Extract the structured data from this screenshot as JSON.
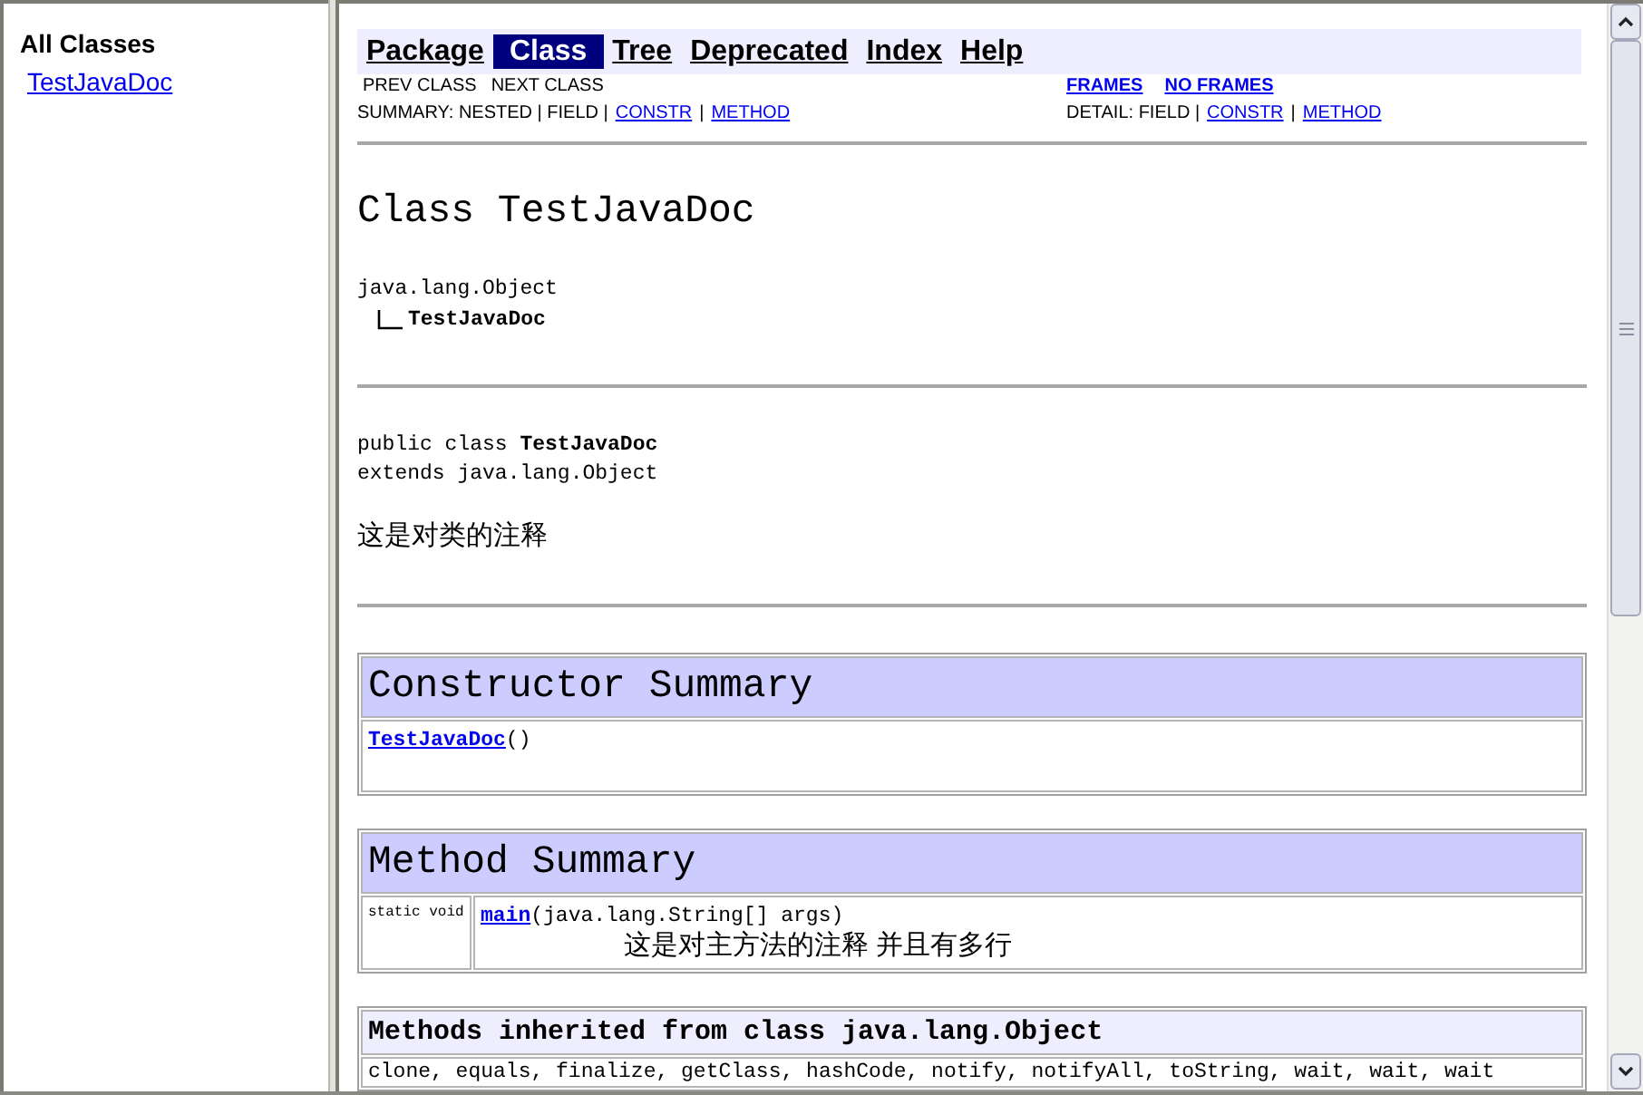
{
  "left_frame": {
    "heading": "All Classes",
    "classes": [
      "TestJavaDoc"
    ]
  },
  "navbar": {
    "items": [
      {
        "label": "Package",
        "selected": false
      },
      {
        "label": "Class",
        "selected": true
      },
      {
        "label": "Tree",
        "selected": false
      },
      {
        "label": "Deprecated",
        "selected": false
      },
      {
        "label": "Index",
        "selected": false
      },
      {
        "label": "Help",
        "selected": false
      }
    ]
  },
  "subnav": {
    "prev_next": [
      "PREV CLASS",
      "NEXT CLASS"
    ],
    "frames": [
      "FRAMES",
      "NO FRAMES"
    ],
    "summary": [
      {
        "kind": "text",
        "text": "SUMMARY: NESTED | FIELD |"
      },
      {
        "kind": "link",
        "text": "CONSTR"
      },
      {
        "kind": "text",
        "text": "|"
      },
      {
        "kind": "link",
        "text": "METHOD"
      }
    ],
    "detail": [
      {
        "kind": "text",
        "text": "DETAIL: FIELD |"
      },
      {
        "kind": "link",
        "text": "CONSTR"
      },
      {
        "kind": "text",
        "text": "|"
      },
      {
        "kind": "link",
        "text": "METHOD"
      }
    ]
  },
  "class_title": "Class TestJavaDoc",
  "hierarchy": {
    "name": "java.lang.Object",
    "children": [
      {
        "name": "TestJavaDoc"
      }
    ]
  },
  "declaration": [
    "public class **TestJavaDoc**",
    "extends java.lang.Object"
  ],
  "description": "这是对类的注释",
  "constructor_summary": {
    "title": "Constructor Summary",
    "rows": [
      {
        "name": "TestJavaDoc",
        "params": "()"
      }
    ]
  },
  "method_summary": {
    "title": "Method Summary",
    "rows": [
      {
        "modifier": "static void",
        "name": "main",
        "params": "(java.lang.String[] args)",
        "description": "这是对主方法的注释 并且有多行"
      }
    ]
  },
  "inherited_methods": {
    "title": "Methods inherited from class java.lang.Object",
    "methods": "clone, equals, finalize, getClass, hashCode, notify, notifyAll, toString, wait, wait, wait"
  }
}
